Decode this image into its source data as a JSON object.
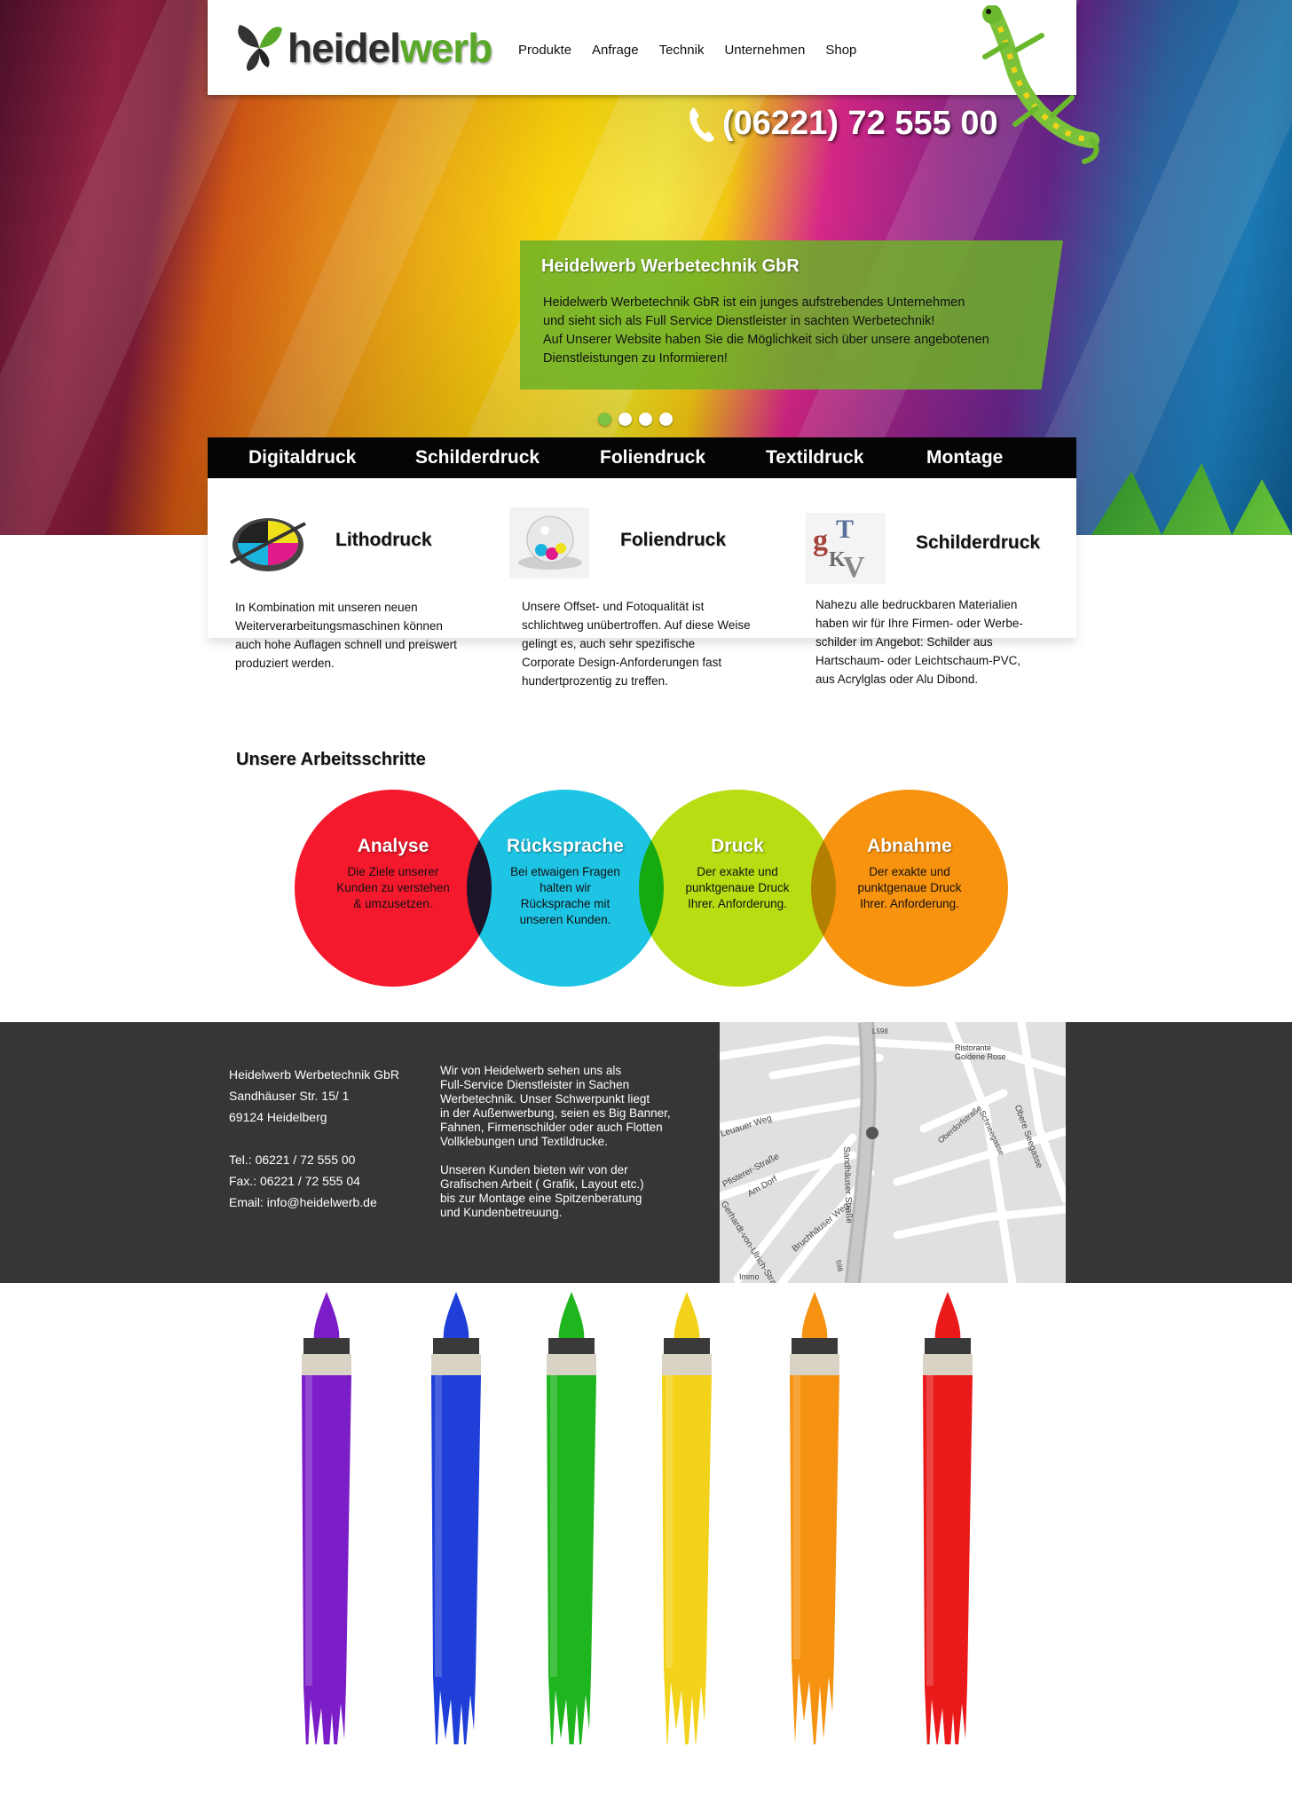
{
  "header": {
    "logo_text_dark": "heidel",
    "logo_text_green": "werb",
    "nav": [
      "Produkte",
      "Anfrage",
      "Technik",
      "Unternehmen",
      "Shop"
    ]
  },
  "hero": {
    "phone": "(06221) 72 555 00",
    "slide_title": "Heidelwerb Werbetechnik GbR",
    "slide_lines": [
      "Heidelwerb Werbetechnik GbR ist ein junges aufstrebendes Unternehmen",
      "und sieht sich als Full Service Dienstleister in sachten Werbetechnik!",
      "Auf Unserer Website haben Sie die Möglichkeit sich über unsere angebotenen",
      "Dienstleistungen zu Informieren!"
    ],
    "slide_count": 4,
    "active_slide": 1
  },
  "services": [
    "Digitaldruck",
    "Schilderdruck",
    "Foliendruck",
    "Textildruck",
    "Montage"
  ],
  "features": [
    {
      "title": "Lithodruck",
      "icon": "color-wheel-icon",
      "lines": [
        "In Kombination mit unseren neuen",
        "Weiterverarbeitungsmaschinen können",
        "auch hohe Auflagen schnell und preiswert",
        "produziert werden."
      ]
    },
    {
      "title": "Foliendruck",
      "icon": "ink-ball-icon",
      "lines": [
        "Unsere Offset- und Fotoqualität ist",
        "schlichtweg unübertroffen. Auf diese Weise",
        "gelingt es, auch sehr spezifische",
        "Corporate Design-Anforderungen fast",
        "hundertprozentig zu treffen."
      ]
    },
    {
      "title": "Schilderdruck",
      "icon": "letters-icon",
      "lines": [
        "Nahezu alle bedruckbaren Materialien",
        "haben wir für Ihre Firmen- oder Werbe-",
        "schilder im Angebot: Schilder aus",
        "Hartschaum- oder Leichtschaum-PVC,",
        "aus Acrylglas oder Alu Dibond."
      ]
    }
  ],
  "steps": {
    "title": "Unsere Arbeitsschritte",
    "items": [
      {
        "title": "Analyse",
        "text": "Die Ziele unserer Kunden zu verstehen & umzusetzen.",
        "color": "#f5192d"
      },
      {
        "title": "Rücksprache",
        "text": "Bei etwaigen Fragen halten wir Rücksprache mit unseren Kunden.",
        "color": "#1ec4e4"
      },
      {
        "title": "Druck",
        "text": "Der exakte und punktgenaue Druck Ihrer. Anforderung.",
        "color": "#b8dd12"
      },
      {
        "title": "Abnahme",
        "text": "Der exakte und punktgenaue Druck Ihrer. Anforderung.",
        "color": "#f8930f"
      }
    ]
  },
  "footer": {
    "address": [
      "Heidelwerb Werbetechnik GbR",
      "Sandhäuser Str. 15/ 1",
      "69124 Heidelberg",
      "",
      "Tel.: 06221 / 72 555 00",
      "Fax.: 06221 / 72 555 04",
      "Email: info@heidelwerb.de"
    ],
    "about": [
      "Wir von Heidelwerb sehen uns als",
      "Full-Service Dienstleister in Sachen",
      "Werbetechnik. Unser Schwerpunkt liegt",
      "in der Außenwerbung, seien es Big Banner,",
      "Fahnen, Firmenschilder oder auch Flotten",
      "Vollklebungen und Textildrucke.",
      "",
      "Unseren Kunden bieten wir von der",
      "Grafischen Arbeit ( Grafik, Layout etc.)",
      "bis zur Montage eine Spitzenberatung",
      "und Kundenbetreuung."
    ],
    "map_labels": [
      "Ristorante",
      "Goldene Rose",
      "Sandhäuser Straße",
      "Bruchhäuser Weg",
      "Am Dorf",
      "Obere Seegasse",
      "Oberdorfstraße",
      "Schneegasse",
      "Leuauer Weg",
      "Pfisterer-Straße",
      "Gerhardt-von-Ulrich-Straße",
      "L598",
      "598",
      "Immo"
    ]
  },
  "brushes": {
    "colors": [
      "#7b1ec8",
      "#1f3fd8",
      "#1fb51f",
      "#f2d21a",
      "#f59212",
      "#ea1a1a"
    ]
  }
}
